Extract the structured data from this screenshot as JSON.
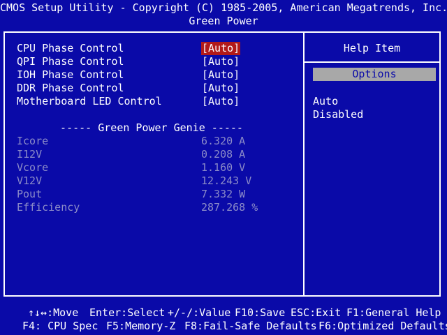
{
  "header": {
    "title": "CMOS Setup Utility - Copyright (C) 1985-2005, American Megatrends, Inc.",
    "subtitle": "Green Power"
  },
  "settings": [
    {
      "label": "CPU Phase Control",
      "value": "[Auto]"
    },
    {
      "label": "QPI Phase Control",
      "value": "[Auto]"
    },
    {
      "label": "IOH Phase Control",
      "value": "[Auto]"
    },
    {
      "label": "DDR Phase Control",
      "value": "[Auto]"
    },
    {
      "label": "Motherboard LED Control",
      "value": "[Auto]"
    }
  ],
  "genie": {
    "heading": "----- Green Power Genie -----",
    "readings": [
      {
        "label": "Icore",
        "value": "6.320 A"
      },
      {
        "label": "I12V",
        "value": "0.208 A"
      },
      {
        "label": "Vcore",
        "value": "1.160 V"
      },
      {
        "label": "V12V",
        "value": "12.243 V"
      },
      {
        "label": "Pout",
        "value": "7.332 W"
      },
      {
        "label": "Efficiency",
        "value": "287.268 %"
      }
    ]
  },
  "help": {
    "title": "Help Item",
    "options_label": "Options",
    "options": [
      "Auto",
      "Disabled"
    ]
  },
  "footer": {
    "line1": [
      {
        "key": "↑↓↔:",
        "action": "Move"
      },
      {
        "key": "Enter:",
        "action": "Select"
      },
      {
        "key": "+/-/:",
        "action": "Value"
      },
      {
        "key": "F10:",
        "action": "Save"
      },
      {
        "key": "ESC:",
        "action": "Exit"
      },
      {
        "key": "F1:",
        "action": "General Help"
      }
    ],
    "line2": [
      {
        "key": "F4:",
        "action": " CPU Spec"
      },
      {
        "key": "F5:",
        "action": "Memory-Z"
      },
      {
        "key": "F8:",
        "action": "Fail-Safe Defaults"
      },
      {
        "key": "F6:",
        "action": "Optimized Defaults"
      }
    ]
  },
  "colors": {
    "background": "#0a0aa8",
    "selected_highlight": "#b11a1a",
    "dim_text": "#8c8cc8",
    "options_box": "#a8a8a8"
  }
}
